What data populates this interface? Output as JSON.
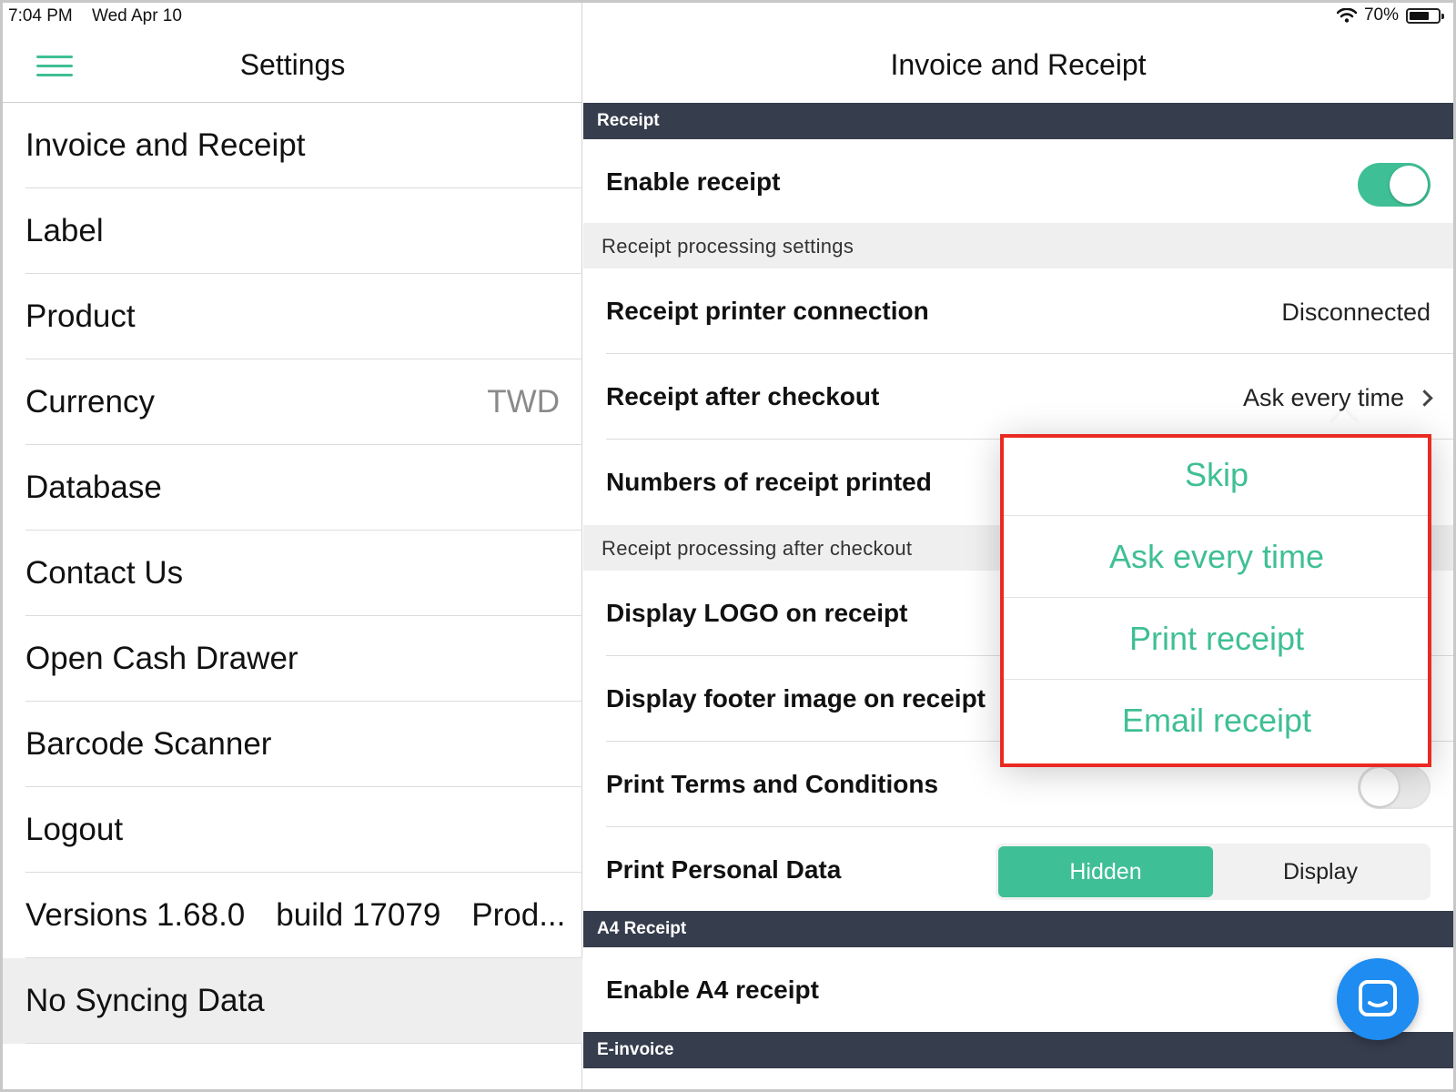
{
  "status_bar": {
    "time": "7:04 PM",
    "date": "Wed Apr 10",
    "battery": "70%"
  },
  "left": {
    "title": "Settings",
    "items": [
      {
        "label": "Invoice and Receipt"
      },
      {
        "label": "Label"
      },
      {
        "label": "Product"
      },
      {
        "label": "Currency",
        "value": "TWD"
      },
      {
        "label": "Database"
      },
      {
        "label": "Contact Us"
      },
      {
        "label": "Open Cash Drawer"
      },
      {
        "label": "Barcode Scanner"
      },
      {
        "label": "Logout"
      }
    ],
    "version": {
      "version": "Versions 1.68.0",
      "build": "build 17079",
      "env": "Prod..."
    },
    "sync_status": "No Syncing Data"
  },
  "right": {
    "title": "Invoice and Receipt",
    "sections": {
      "receipt": "Receipt",
      "processing": "Receipt processing settings",
      "after_checkout": "Receipt processing after checkout",
      "a4": "A4 Receipt",
      "einvoice": "E-invoice"
    },
    "rows": {
      "enable_receipt": {
        "label": "Enable receipt",
        "on": true
      },
      "printer_connection": {
        "label": "Receipt printer connection",
        "value": "Disconnected"
      },
      "after_checkout": {
        "label": "Receipt after checkout",
        "value": "Ask every time"
      },
      "num_printed": {
        "label": "Numbers of receipt printed"
      },
      "display_logo": {
        "label": "Display LOGO on receipt"
      },
      "display_footer": {
        "label": "Display footer image on receipt"
      },
      "terms": {
        "label": "Print Terms and Conditions",
        "on": false
      },
      "personal_data": {
        "label": "Print Personal Data",
        "options": [
          "Hidden",
          "Display"
        ],
        "selected": "Hidden"
      },
      "enable_a4": {
        "label": "Enable A4 receipt"
      }
    }
  },
  "popover": {
    "options": [
      "Skip",
      "Ask every time",
      "Print receipt",
      "Email receipt"
    ]
  },
  "colors": {
    "accent": "#3fbf95",
    "section_dark": "#363d4d",
    "highlight": "#ea2a22",
    "fab": "#1e8cf0"
  },
  "icons": {
    "menu": "hamburger-icon",
    "wifi": "wifi-icon",
    "battery": "battery-icon",
    "chevron": "chevron-right-icon",
    "chat": "chat-icon"
  }
}
